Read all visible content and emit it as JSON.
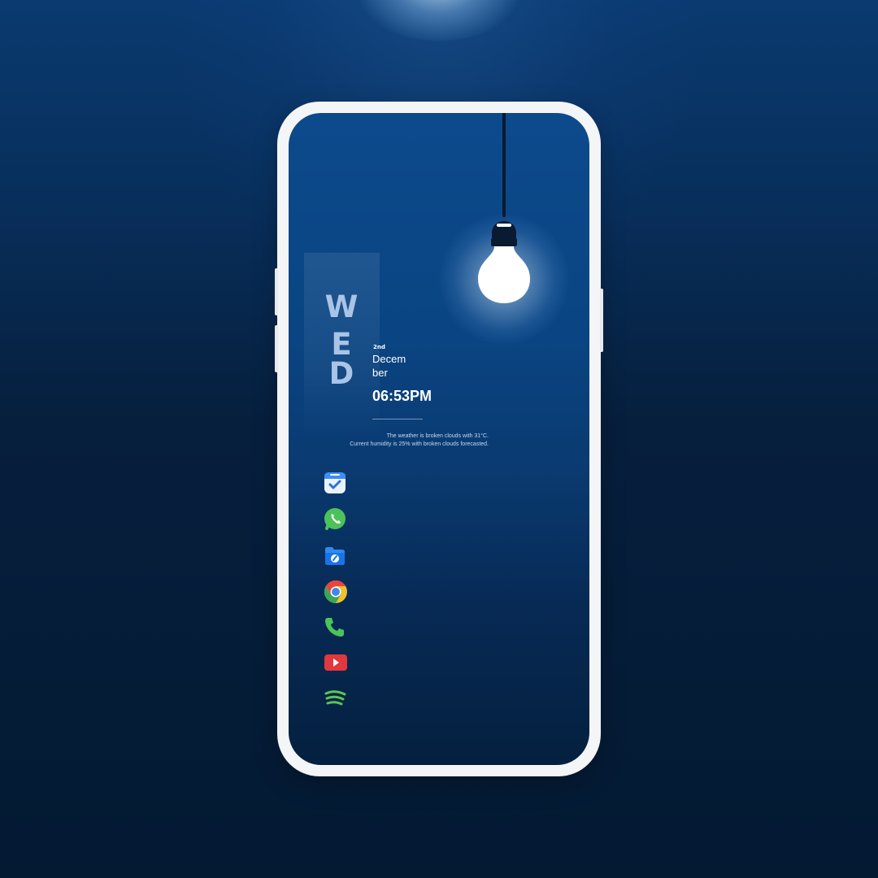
{
  "home": {
    "day_letters": [
      "W",
      "E",
      "D"
    ],
    "date_number": "2nd",
    "month_line1": "Decem",
    "month_line2": "ber",
    "time": "06:53PM",
    "weather_line1": "The weather is broken clouds with 31°C.",
    "weather_line2": "Current humidity is 25% with broken clouds forecasted."
  },
  "apps": [
    {
      "icon": "tasks-icon"
    },
    {
      "icon": "whatsapp-icon"
    },
    {
      "icon": "files-icon"
    },
    {
      "icon": "chrome-icon"
    },
    {
      "icon": "phone-icon"
    },
    {
      "icon": "youtube-icon"
    },
    {
      "icon": "spotify-icon"
    }
  ],
  "colors": {
    "background": "#062040",
    "screen_top": "#0c4a8c",
    "day_letters": "#a9c4e6",
    "phone_frame": "#f4f5f7"
  }
}
